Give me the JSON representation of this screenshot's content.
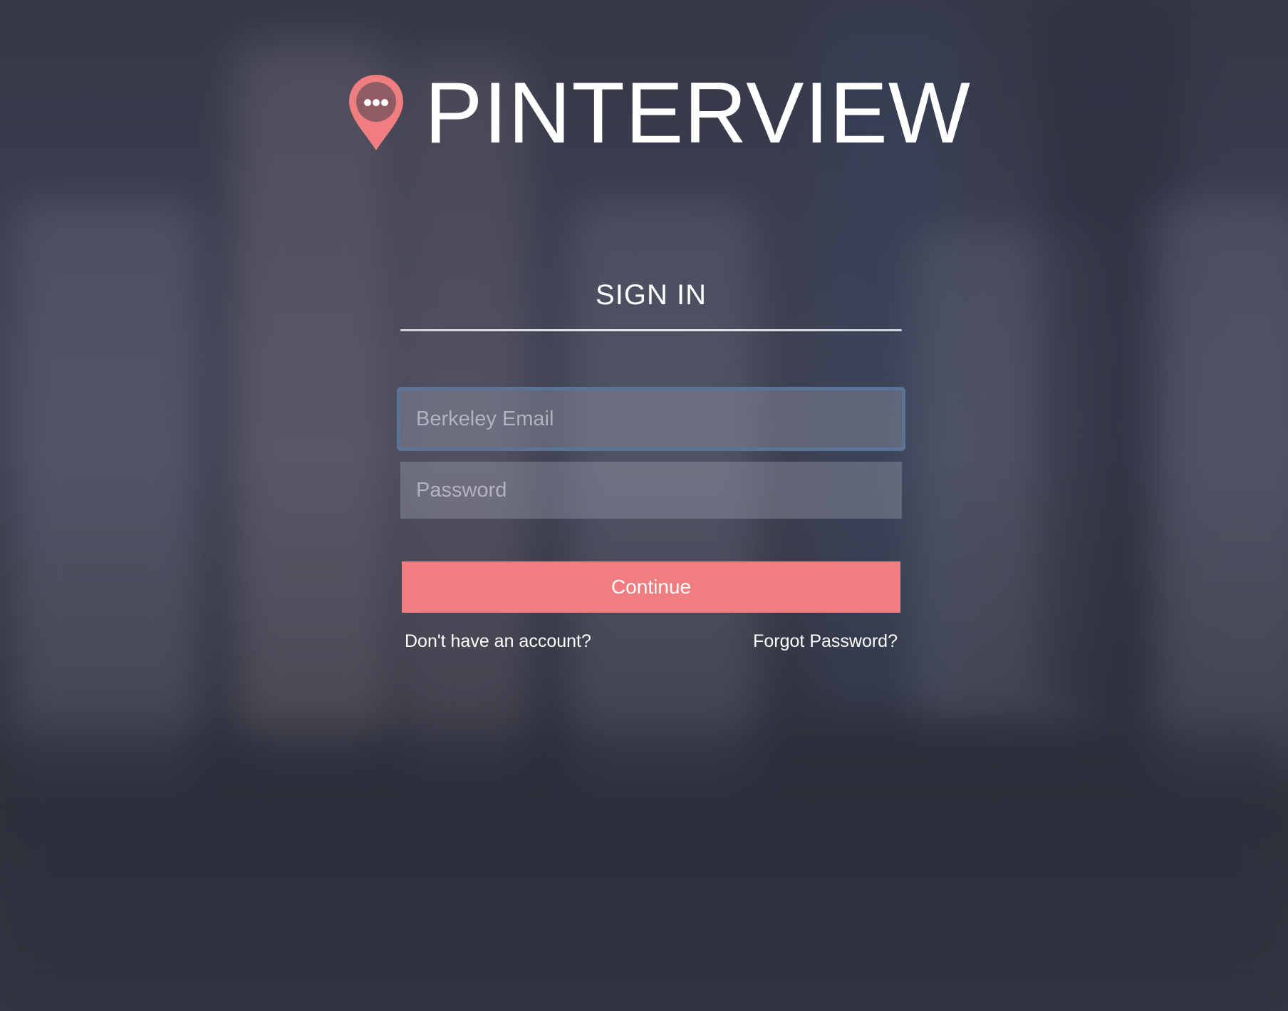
{
  "brand": {
    "name": "PINTERVIEW",
    "icon": "map-pin-chat-icon",
    "accent_color": "#f07d80"
  },
  "signin": {
    "heading": "SIGN IN",
    "email_placeholder": "Berkeley Email",
    "password_placeholder": "Password",
    "continue_label": "Continue",
    "signup_link": "Don't have an account?",
    "forgot_link": "Forgot Password?"
  },
  "colors": {
    "focus_border": "#5b7396",
    "button": "#f07d80",
    "text": "#ffffff"
  }
}
